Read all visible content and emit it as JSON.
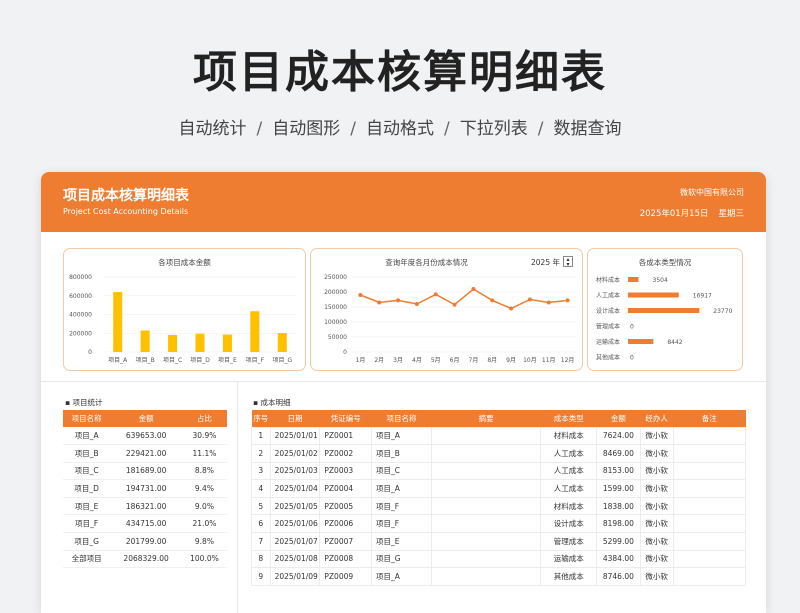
{
  "hero": {
    "title": "项目成本核算明细表",
    "subtitle": [
      "自动统计",
      "自动图形",
      "自动格式",
      "下拉列表",
      "数据查询"
    ],
    "separator": "/"
  },
  "banner": {
    "title": "项目成本核算明细表",
    "subtitle": "Project Cost Accounting Details",
    "company": "微软中国有限公司",
    "date": "2025年01月15日",
    "weekday": "星期三",
    "color": "#ee7d31"
  },
  "chart_data": [
    {
      "type": "bar",
      "title": "各项目成本金额",
      "categories": [
        "项目_A",
        "项目_B",
        "项目_C",
        "项目_D",
        "项目_E",
        "项目_F",
        "项目_G"
      ],
      "values": [
        639653,
        229421,
        181689,
        194731,
        186321,
        434715,
        201799
      ],
      "yticks": [
        "0",
        "200000",
        "400000",
        "600000",
        "800000"
      ],
      "ylim": [
        0,
        800000
      ],
      "color": "#ffc000"
    },
    {
      "type": "line",
      "title": "查询年度各月份成本情况",
      "year": "2025 年",
      "categories": [
        "1月",
        "2月",
        "3月",
        "4月",
        "5月",
        "6月",
        "7月",
        "8月",
        "9月",
        "10月",
        "11月",
        "12月"
      ],
      "values": [
        190000,
        165000,
        172000,
        160000,
        192000,
        158000,
        210000,
        172000,
        145000,
        175000,
        165000,
        172000
      ],
      "yticks": [
        "0",
        "50000",
        "100000",
        "150000",
        "200000",
        "250000"
      ],
      "ylim": [
        0,
        250000
      ],
      "color": "#ee7d31"
    },
    {
      "type": "bar",
      "orientation": "horizontal",
      "title": "各成本类型情况",
      "categories": [
        "材料成本",
        "人工成本",
        "设计成本",
        "管理成本",
        "运输成本",
        "其他成本"
      ],
      "values": [
        3504,
        16917,
        23770,
        0,
        8442,
        0
      ],
      "xlim": [
        0,
        30000
      ],
      "color": "#ee7d31"
    }
  ],
  "stats": {
    "title": "项目统计",
    "headers": [
      "项目名称",
      "金额",
      "占比"
    ],
    "rows": [
      [
        "项目_A",
        "639653.00",
        "30.9%"
      ],
      [
        "项目_B",
        "229421.00",
        "11.1%"
      ],
      [
        "项目_C",
        "181689.00",
        "8.8%"
      ],
      [
        "项目_D",
        "194731.00",
        "9.4%"
      ],
      [
        "项目_E",
        "186321.00",
        "9.0%"
      ],
      [
        "项目_F",
        "434715.00",
        "21.0%"
      ],
      [
        "项目_G",
        "201799.00",
        "9.8%"
      ],
      [
        "全部项目",
        "2068329.00",
        "100.0%"
      ]
    ]
  },
  "detail": {
    "title": "成本明细",
    "headers": [
      "序号",
      "日期",
      "凭证编号",
      "项目名称",
      "摘要",
      "成本类型",
      "金额",
      "经办人",
      "备注"
    ],
    "rows": [
      [
        "1",
        "2025/01/01",
        "PZ0001",
        "项目_A",
        "",
        "材料成本",
        "7624.00",
        "微小软",
        ""
      ],
      [
        "2",
        "2025/01/02",
        "PZ0002",
        "项目_B",
        "",
        "人工成本",
        "8469.00",
        "微小软",
        ""
      ],
      [
        "3",
        "2025/01/03",
        "PZ0003",
        "项目_C",
        "",
        "人工成本",
        "8153.00",
        "微小软",
        ""
      ],
      [
        "4",
        "2025/01/04",
        "PZ0004",
        "项目_A",
        "",
        "人工成本",
        "1599.00",
        "微小软",
        ""
      ],
      [
        "5",
        "2025/01/05",
        "PZ0005",
        "项目_F",
        "",
        "材料成本",
        "1838.00",
        "微小软",
        ""
      ],
      [
        "6",
        "2025/01/06",
        "PZ0006",
        "项目_F",
        "",
        "设计成本",
        "8198.00",
        "微小软",
        ""
      ],
      [
        "7",
        "2025/01/07",
        "PZ0007",
        "项目_E",
        "",
        "管理成本",
        "5299.00",
        "微小软",
        ""
      ],
      [
        "8",
        "2025/01/08",
        "PZ0008",
        "项目_G",
        "",
        "运输成本",
        "4384.00",
        "微小软",
        ""
      ],
      [
        "9",
        "2025/01/09",
        "PZ0009",
        "项目_A",
        "",
        "其他成本",
        "8746.00",
        "微小软",
        ""
      ]
    ]
  }
}
